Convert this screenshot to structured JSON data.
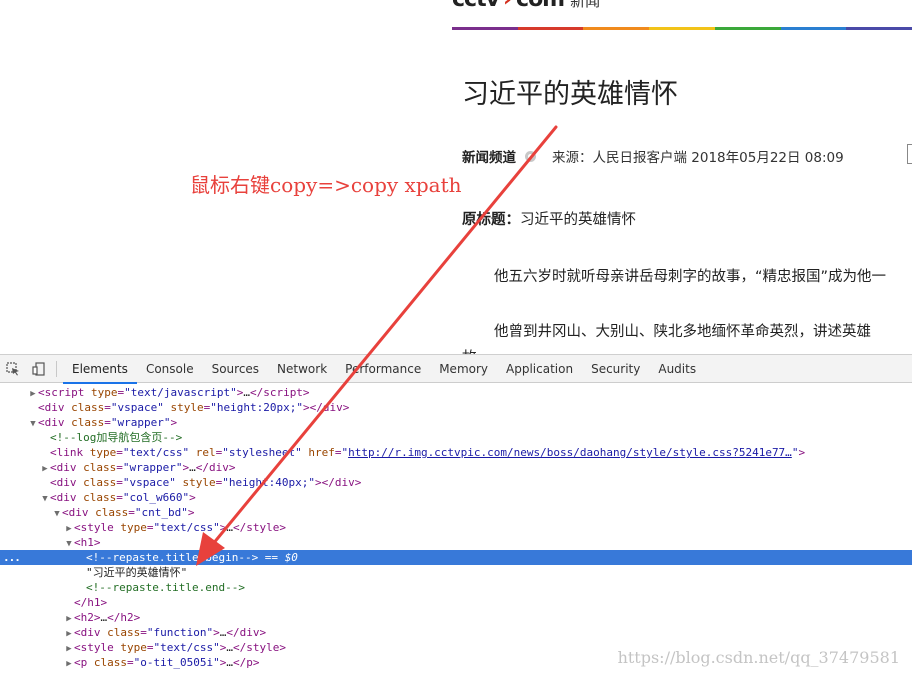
{
  "site": {
    "logo_text": "cctv",
    "logo_mark": "›",
    "logo_domain": "com",
    "logo_section": "新闻",
    "rainbow_colors": [
      "#7a2f8c",
      "#d63a2b",
      "#f08a1d",
      "#f2c318",
      "#3ba83a",
      "#2a7fd1",
      "#4a4aa8"
    ]
  },
  "article": {
    "title": "习近平的英雄情怀",
    "channel": "新闻频道",
    "source": "来源：人民日报客户端 2018年05月22日 08:09",
    "orig_label": "原标题：",
    "orig_title": "习近平的英雄情怀",
    "para1": "他五六岁时就听母亲讲岳母刺字的故事，“精忠报国”成为他一",
    "para2": "他曾到井冈山、大别山、陕北多地缅怀革命英烈，讲述英雄",
    "para2_tail": "故"
  },
  "annotation": "鼠标右键copy=>copy xpath",
  "devtools": {
    "tabs": [
      "Elements",
      "Console",
      "Sources",
      "Network",
      "Performance",
      "Memory",
      "Application",
      "Security",
      "Audits"
    ],
    "active_tab": "Elements",
    "selected_text_node": "\"习近平的英雄情怀\"",
    "dollar_hint": "== $0"
  },
  "watermark": "https://blog.csdn.net/qq_37479581",
  "colors": {
    "annotation": "#e8413c",
    "selection": "#3879d9",
    "arrow": "#e8413c"
  }
}
